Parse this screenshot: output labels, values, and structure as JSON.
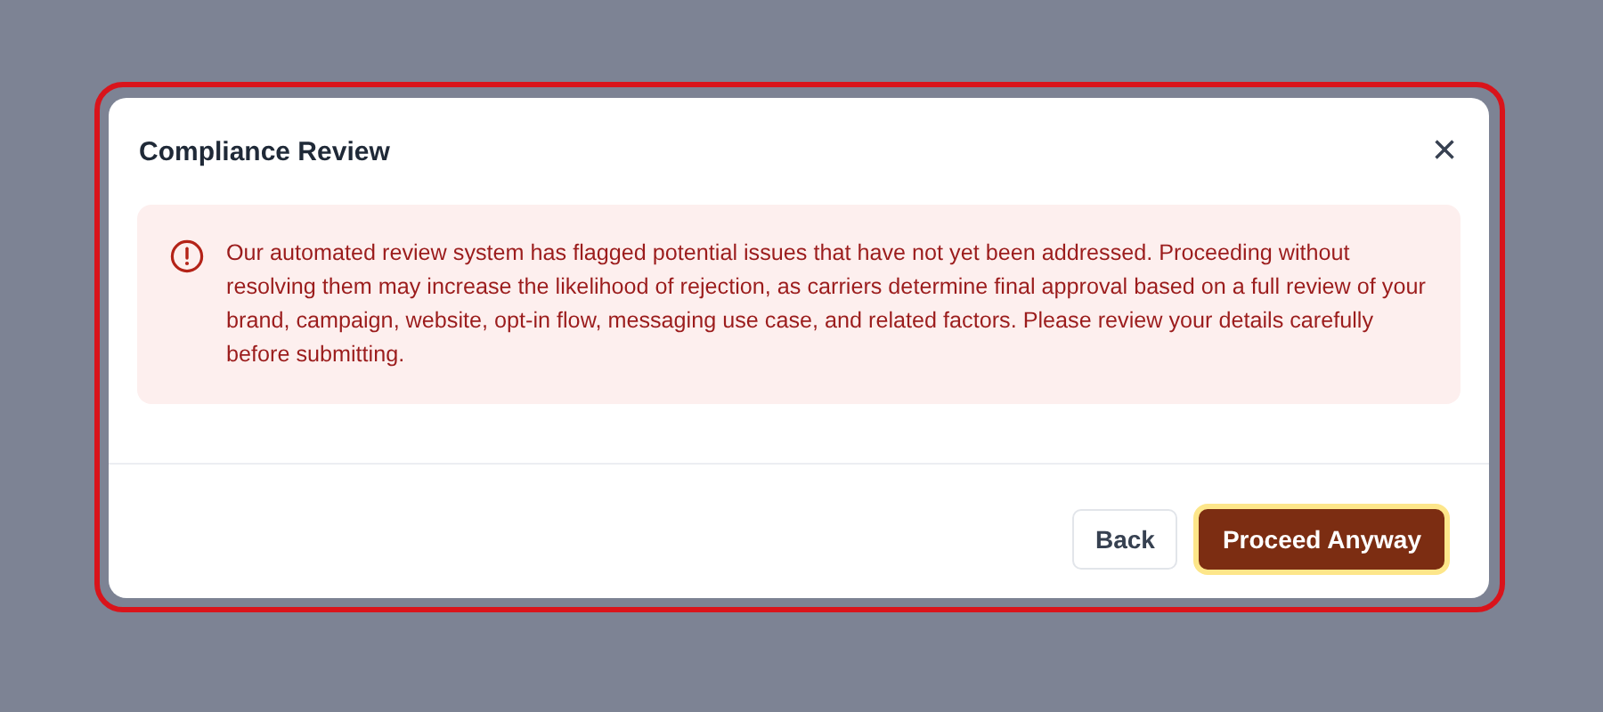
{
  "dialog": {
    "title": "Compliance Review",
    "close": "×",
    "alert": {
      "kind": "error",
      "message": "Our automated review system has flagged potential issues that have not yet been addressed. Proceeding without resolving them may increase the likelihood of rejection, as carriers determine final approval based on a full review of your brand, campaign, website, opt-in flow, messaging use case, and related factors. Please review your details carefully before submitting."
    },
    "buttons": [
      {
        "label": "Back",
        "kind": "secondary",
        "focused": false
      },
      {
        "label": "Proceed Anyway",
        "kind": "primary",
        "focused": true
      }
    ]
  }
}
